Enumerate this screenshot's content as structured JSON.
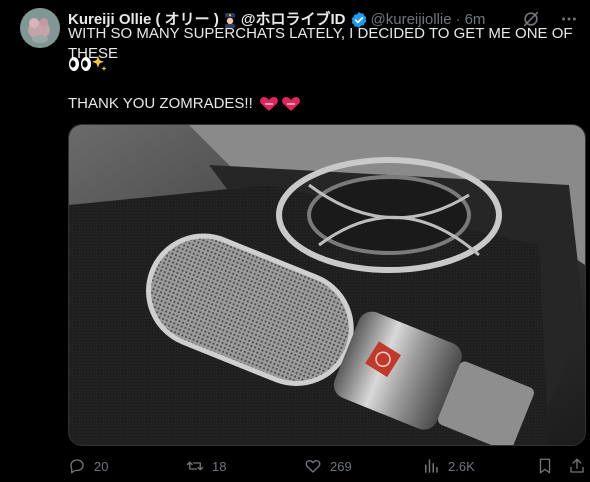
{
  "tweet": {
    "author_name": "Kureiji Ollie ( オリー )",
    "author_affiliation": "@ホロライブID",
    "handle": "@kureijiollie",
    "separator": "·",
    "time": "6m",
    "line1": "WITH SO MANY SUPERCHATS LATELY, I DECIDED TO GET ME ONE OF THESE",
    "line2": "THANK YOU ZOMRADES!!"
  },
  "actions": {
    "replies": "20",
    "retweets": "18",
    "likes": "269",
    "views": "2.6K"
  },
  "icons": {
    "verified": "verified-badge-icon",
    "grok": "grok-icon",
    "more": "more-icon",
    "reply": "reply-icon",
    "retweet": "retweet-icon",
    "like": "like-icon",
    "views": "views-icon",
    "bookmark": "bookmark-icon",
    "share": "share-icon"
  },
  "colors": {
    "background": "#000000",
    "text": "#e7e9ea",
    "muted": "#71767b",
    "verified": "#1d9bf0"
  }
}
